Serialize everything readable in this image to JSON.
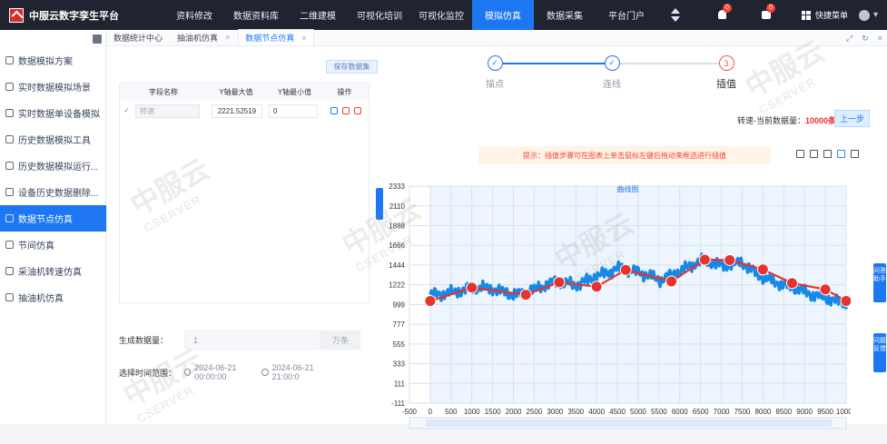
{
  "app": {
    "title": "中服云数字孪生平台"
  },
  "top_nav": [
    {
      "label": "资料修改"
    },
    {
      "label": "数据资料库"
    },
    {
      "label": "二维建模"
    },
    {
      "label": "可视化培训"
    },
    {
      "label": "可视化监控"
    },
    {
      "label": "模拟仿真"
    },
    {
      "label": "数据采集"
    },
    {
      "label": "平台门户"
    }
  ],
  "header": {
    "bell_count": "0",
    "message_count": "0",
    "quick_menu_label": "快捷菜单"
  },
  "sidebar": [
    {
      "label": "数据模拟方案"
    },
    {
      "label": "实时数据模拟场景"
    },
    {
      "label": "实时数据单设备模拟"
    },
    {
      "label": "历史数据模拟工具"
    },
    {
      "label": "历史数据模拟运行..."
    },
    {
      "label": "设备历史数据删除..."
    },
    {
      "label": "数据节点仿真"
    },
    {
      "label": "节间仿真"
    },
    {
      "label": "采油机转速仿真"
    },
    {
      "label": "抽油机仿真"
    }
  ],
  "tabs": [
    {
      "label": "数据统计中心"
    },
    {
      "label": "抽油机仿真"
    },
    {
      "label": "数据节点仿真"
    }
  ],
  "left_panel": {
    "save_button": "保存数据集",
    "columns": [
      "字段名称",
      "Y轴最大值",
      "Y轴最小值",
      "操作"
    ],
    "row": {
      "field_placeholder": "转速",
      "ymax": "2221.52519",
      "ymin": "0"
    },
    "generate_label": "生成数据量：",
    "generate_value": "1",
    "generate_unit": "万条",
    "time_label": "选择时间范围：",
    "time_start": "2024-06-21 00:00:00",
    "time_end": "2024-06-21 21:00:0"
  },
  "steps": [
    {
      "number": "✓",
      "label": "描点"
    },
    {
      "number": "✓",
      "label": "连线"
    },
    {
      "number": "3",
      "label": "插值"
    }
  ],
  "status": {
    "prefix": "转速-当前数据量：",
    "count": "10000条",
    "prev_button": "上一步"
  },
  "hint": "提示：插值步骤可在图表上单击鼠标左键后拖动来框选进行插值",
  "watermark": {
    "primary": "中服云",
    "secondary": "CSERVER"
  },
  "help": {
    "assistant": "问答助手",
    "feedback": "问题反馈"
  },
  "chart_data": {
    "type": "line",
    "title": "曲线图",
    "xlabel": "",
    "ylabel": "",
    "xlim": [
      -500,
      10000
    ],
    "ylim": [
      -111,
      2333
    ],
    "x_ticks": [
      -500,
      0,
      500,
      1000,
      1500,
      2000,
      2500,
      3000,
      3500,
      4000,
      4500,
      5000,
      5500,
      6000,
      6500,
      7000,
      7500,
      8000,
      8500,
      9000,
      9500,
      10000
    ],
    "y_ticks": [
      -111,
      111,
      333,
      555,
      777,
      999,
      1222,
      1444,
      1666,
      1888,
      2110,
      2333
    ],
    "series": [
      {
        "name": "",
        "values_x": [
          0,
          500,
          1000,
          1500,
          2000,
          2500,
          3000,
          3500,
          4000,
          4500,
          5000,
          5500,
          6000,
          6500,
          7000,
          7500,
          8000,
          8500,
          9000,
          9500,
          10000
        ],
        "values_y": [
          1110,
          1130,
          1190,
          1180,
          1105,
          1165,
          1260,
          1220,
          1315,
          1405,
          1370,
          1275,
          1370,
          1500,
          1440,
          1470,
          1300,
          1225,
          1145,
          1070,
          1020
        ]
      },
      {
        "name": "",
        "points_x": [
          0,
          1000,
          2300,
          3100,
          4000,
          4700,
          5800,
          6600,
          7200,
          8000,
          8700,
          9500,
          10000
        ],
        "points_y": [
          1040,
          1190,
          1110,
          1250,
          1200,
          1390,
          1260,
          1505,
          1500,
          1395,
          1240,
          1170,
          1040
        ]
      }
    ],
    "grid": true,
    "legend": "none"
  }
}
